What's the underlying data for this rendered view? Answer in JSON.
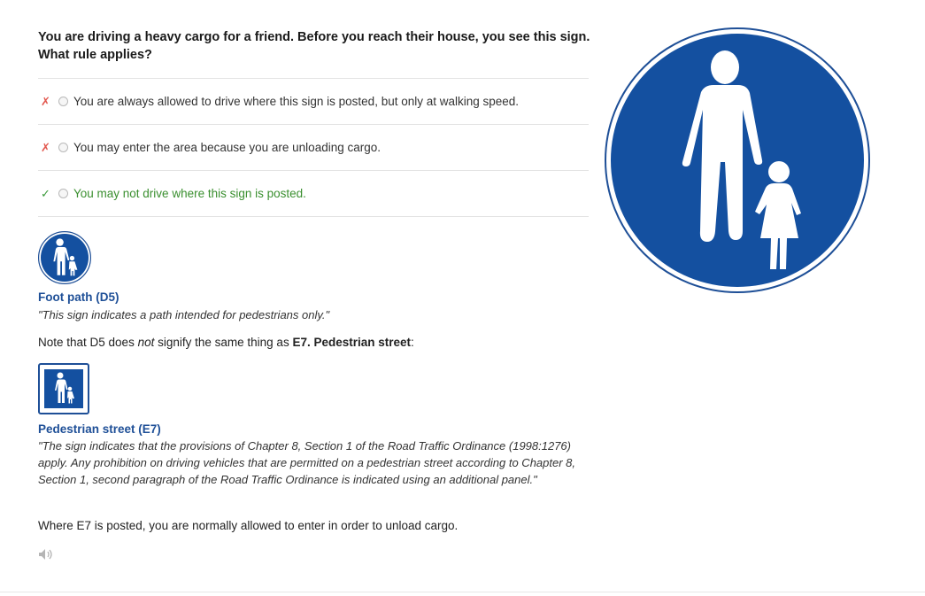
{
  "question": {
    "text": "You are driving a heavy cargo for a friend. Before you reach their house, you see this sign. What rule applies?"
  },
  "answers": [
    {
      "mark": "✗",
      "text": "You are always allowed to drive where this sign is posted, but only at walking speed.",
      "correct": false
    },
    {
      "mark": "✗",
      "text": "You may enter the area because you are unloading cargo.",
      "correct": false
    },
    {
      "mark": "✓",
      "text": "You may not drive where this sign is posted.",
      "correct": true
    }
  ],
  "explanation": {
    "d5": {
      "name": "Foot path (D5)",
      "quote": "\"This sign indicates a path intended for pedestrians only.\""
    },
    "note": {
      "part1": "Note that D5 does ",
      "emphasis": "not",
      "part2": " signify the same thing as ",
      "strong": "E7. Pedestrian street",
      "part3": ":"
    },
    "e7": {
      "name": "Pedestrian street (E7)",
      "quote": "\"The sign indicates that the provisions of Chapter 8, Section 1 of the Road Traffic Ordinance (1998:1276) apply. Any prohibition on driving vehicles that are permitted on a pedestrian street according to Chapter 8, Section 1, second paragraph of the Road Traffic Ordinance is indicated using an additional panel.\""
    },
    "closing": "Where E7 is posted, you are normally allowed to enter in order to unload cargo."
  },
  "icons": {
    "speaker": "speaker-icon",
    "big_sign": "pedestrian-sign-icon"
  },
  "colors": {
    "sign_blue": "#1450a0",
    "link_blue": "#1e4f97",
    "correct_green": "#3a8f2f",
    "wrong_red": "#e2584f"
  }
}
